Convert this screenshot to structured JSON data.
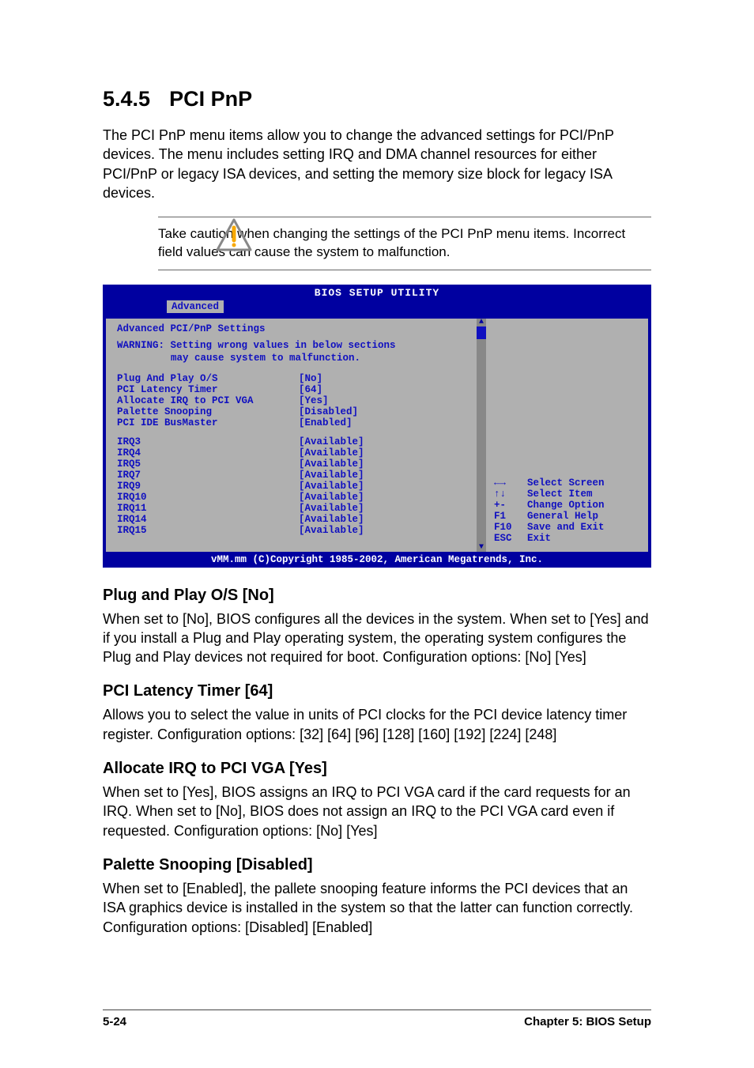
{
  "heading": {
    "number": "5.4.5",
    "title": "PCI PnP"
  },
  "intro": "The PCI PnP menu items allow you to change the advanced settings for PCI/PnP devices. The menu includes setting IRQ and DMA channel resources for either PCI/PnP or legacy ISA devices, and setting the memory size block for legacy ISA devices.",
  "caution": "Take caution when changing the settings of the PCI PnP menu items. Incorrect field values can cause the system to malfunction.",
  "bios": {
    "title": "BIOS SETUP UTILITY",
    "tab": "Advanced",
    "subtitle": "Advanced PCI/PnP Settings",
    "warning_line1": "WARNING: Setting wrong values in below sections",
    "warning_line2": "may cause system to malfunction.",
    "settings": [
      {
        "k": "Plug And Play O/S",
        "v": "[No]"
      },
      {
        "k": "PCI Latency Timer",
        "v": "[64]"
      },
      {
        "k": "Allocate IRQ to PCI VGA",
        "v": "[Yes]"
      },
      {
        "k": "Palette Snooping",
        "v": "[Disabled]"
      },
      {
        "k": "PCI IDE BusMaster",
        "v": "[Enabled]"
      }
    ],
    "irqs": [
      {
        "k": "IRQ3",
        "v": "[Available]"
      },
      {
        "k": "IRQ4",
        "v": "[Available]"
      },
      {
        "k": "IRQ5",
        "v": "[Available]"
      },
      {
        "k": "IRQ7",
        "v": "[Available]"
      },
      {
        "k": "IRQ9",
        "v": "[Available]"
      },
      {
        "k": "IRQ10",
        "v": "[Available]"
      },
      {
        "k": "IRQ11",
        "v": "[Available]"
      },
      {
        "k": "IRQ14",
        "v": "[Available]"
      },
      {
        "k": "IRQ15",
        "v": "[Available]"
      }
    ],
    "help": [
      {
        "key": "←→",
        "label": "Select Screen"
      },
      {
        "key": "↑↓",
        "label": "Select Item"
      },
      {
        "key": "+-",
        "label": "Change Option"
      },
      {
        "key": "F1",
        "label": "General Help"
      },
      {
        "key": "F10",
        "label": "Save and Exit"
      },
      {
        "key": "ESC",
        "label": "Exit"
      }
    ],
    "copyright": "vMM.mm (C)Copyright 1985-2002, American Megatrends, Inc."
  },
  "subs": [
    {
      "title": "Plug and Play O/S [No]",
      "body": "When set to [No], BIOS configures all the devices in the system. When set to [Yes] and if you install a Plug and Play operating system, the operating system configures the Plug and Play devices not required for boot. Configuration options: [No] [Yes]"
    },
    {
      "title": "PCI Latency Timer [64]",
      "body": "Allows you to select the value in units of PCI clocks for the PCI device latency timer register. Configuration options: [32] [64] [96] [128] [160] [192] [224] [248]"
    },
    {
      "title": "Allocate IRQ to PCI VGA [Yes]",
      "body": "When set to [Yes], BIOS assigns an IRQ to PCI VGA card if the card requests for an IRQ. When set to [No], BIOS does not assign an IRQ to the PCI VGA card even if requested. Configuration options: [No] [Yes]"
    },
    {
      "title": "Palette Snooping [Disabled]",
      "body": "When set to [Enabled], the pallete snooping feature informs the PCI devices that an ISA graphics device is installed in the system so that the latter can function correctly. Configuration options: [Disabled] [Enabled]"
    }
  ],
  "footer": {
    "left": "5-24",
    "right": "Chapter 5: BIOS Setup"
  }
}
